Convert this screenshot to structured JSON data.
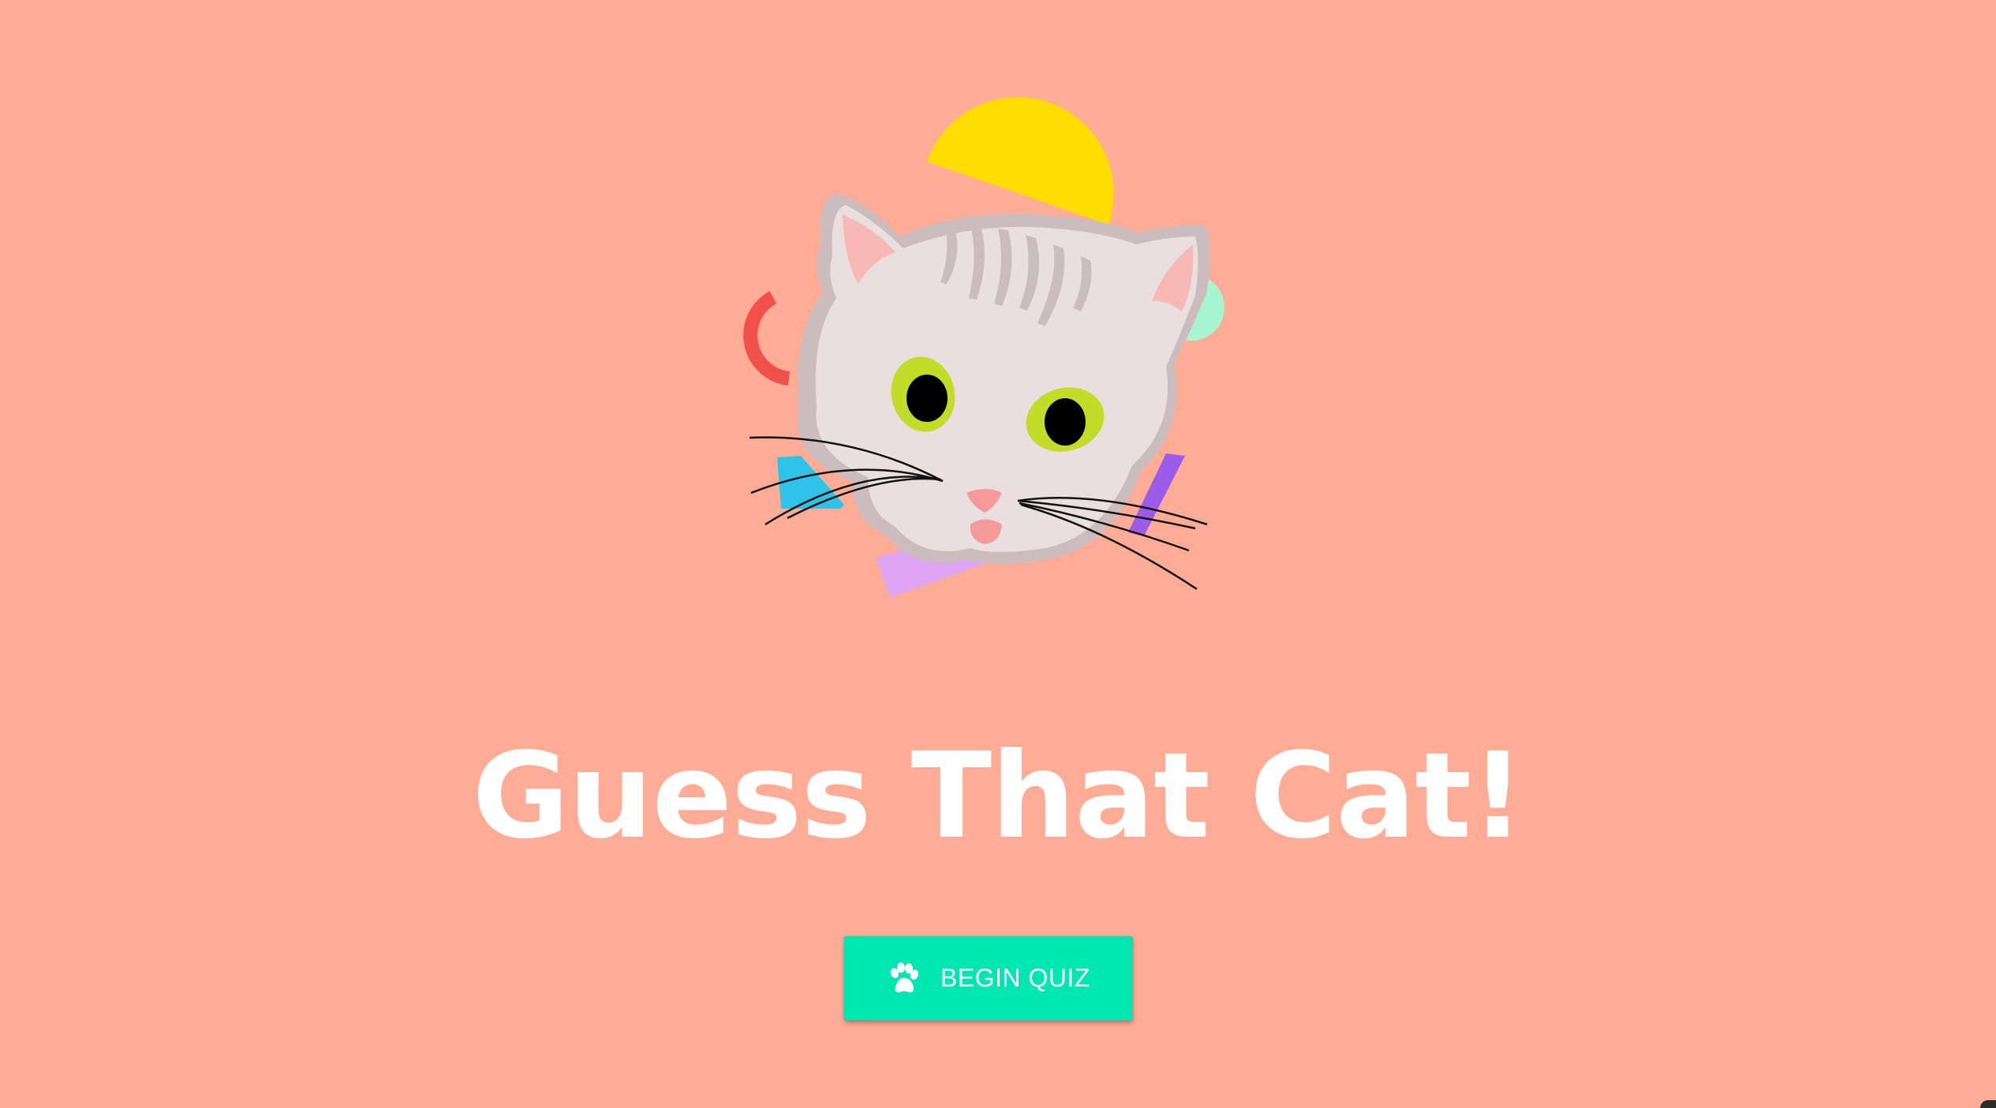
{
  "page": {
    "background_color": "#ffac96"
  },
  "hero": {
    "image_alt": "Cartoon tabby cat face with colorful shapes",
    "colors": {
      "yellow": "#ffdd00",
      "red": "#f2504b",
      "mint": "#a8f5d2",
      "cyan": "#2fc3e8",
      "purple": "#9b5ce8",
      "lilac": "#dea5f2",
      "fur": "#e9dfde",
      "fur_shadow": "#cbbdbd",
      "ear_pink": "#f7b9b5",
      "eye": "#c3dc29",
      "nose": "#f59a9a"
    }
  },
  "title": {
    "text": "Guess That Cat!"
  },
  "cta": {
    "label": "BEGIN QUIZ",
    "icon": "paw-icon",
    "color": "#00e6b3"
  }
}
